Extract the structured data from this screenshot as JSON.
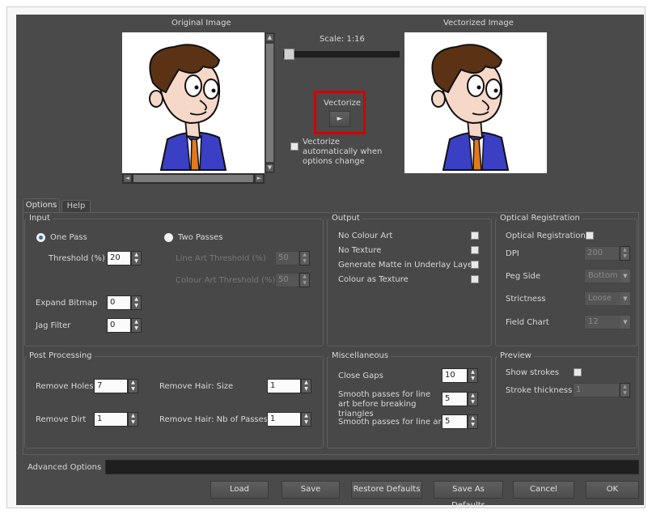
{
  "preview": {
    "original_label": "Original Image",
    "vectorized_label": "Vectorized Image",
    "scale_label": "Scale: 1:16",
    "vectorize_label": "Vectorize",
    "vectorize_button_glyph": "►",
    "auto_vectorize_label": "Vectorize automatically when options change",
    "auto_vectorize_checked": false,
    "highlight_color": "#d40000"
  },
  "tabs": [
    {
      "label": "Options",
      "active": true
    },
    {
      "label": "Help",
      "active": false
    }
  ],
  "input": {
    "title": "Input",
    "one_pass_label": "One Pass",
    "two_passes_label": "Two Passes",
    "selected": "One Pass",
    "threshold_label": "Threshold (%)",
    "threshold_value": "20",
    "line_art_threshold_label": "Line Art Threshold (%)",
    "line_art_threshold_value": "50",
    "colour_art_threshold_label": "Colour Art Threshold (%)",
    "colour_art_threshold_value": "50",
    "expand_bitmap_label": "Expand Bitmap",
    "expand_bitmap_value": "0",
    "jag_filter_label": "Jag Filter",
    "jag_filter_value": "0"
  },
  "output": {
    "title": "Output",
    "no_colour_art": "No Colour Art",
    "no_texture": "No Texture",
    "generate_matte": "Generate Matte in Underlay Layer",
    "colour_as_texture": "Colour as Texture"
  },
  "optical_registration": {
    "title": "Optical Registration",
    "checkbox_label": "Optical Registration",
    "dpi_label": "DPI",
    "dpi_value": "200",
    "peg_side_label": "Peg Side",
    "peg_side_value": "Bottom",
    "strictness_label": "Strictness",
    "strictness_value": "Loose",
    "field_chart_label": "Field Chart",
    "field_chart_value": "12"
  },
  "post_processing": {
    "title": "Post Processing",
    "remove_holes_label": "Remove Holes",
    "remove_holes_value": "7",
    "remove_dirt_label": "Remove Dirt",
    "remove_dirt_value": "1",
    "remove_hair_size_label": "Remove Hair: Size",
    "remove_hair_size_value": "1",
    "remove_hair_passes_label": "Remove Hair: Nb of Passes",
    "remove_hair_passes_value": "1"
  },
  "miscellaneous": {
    "title": "Miscellaneous",
    "close_gaps_label": "Close Gaps",
    "close_gaps_value": "10",
    "smooth_before_label": "Smooth passes for line art before breaking triangles",
    "smooth_before_value": "5",
    "smooth_label": "Smooth passes for line art",
    "smooth_value": "5"
  },
  "preview_group": {
    "title": "Preview",
    "show_strokes_label": "Show strokes",
    "stroke_thickness_label": "Stroke thickness",
    "stroke_thickness_value": "1"
  },
  "advanced_options_label": "Advanced Options",
  "buttons": {
    "load": "Load",
    "save": "Save",
    "restore_defaults": "Restore Defaults",
    "save_as_defaults": "Save As Defaults",
    "cancel": "Cancel",
    "ok": "OK"
  }
}
